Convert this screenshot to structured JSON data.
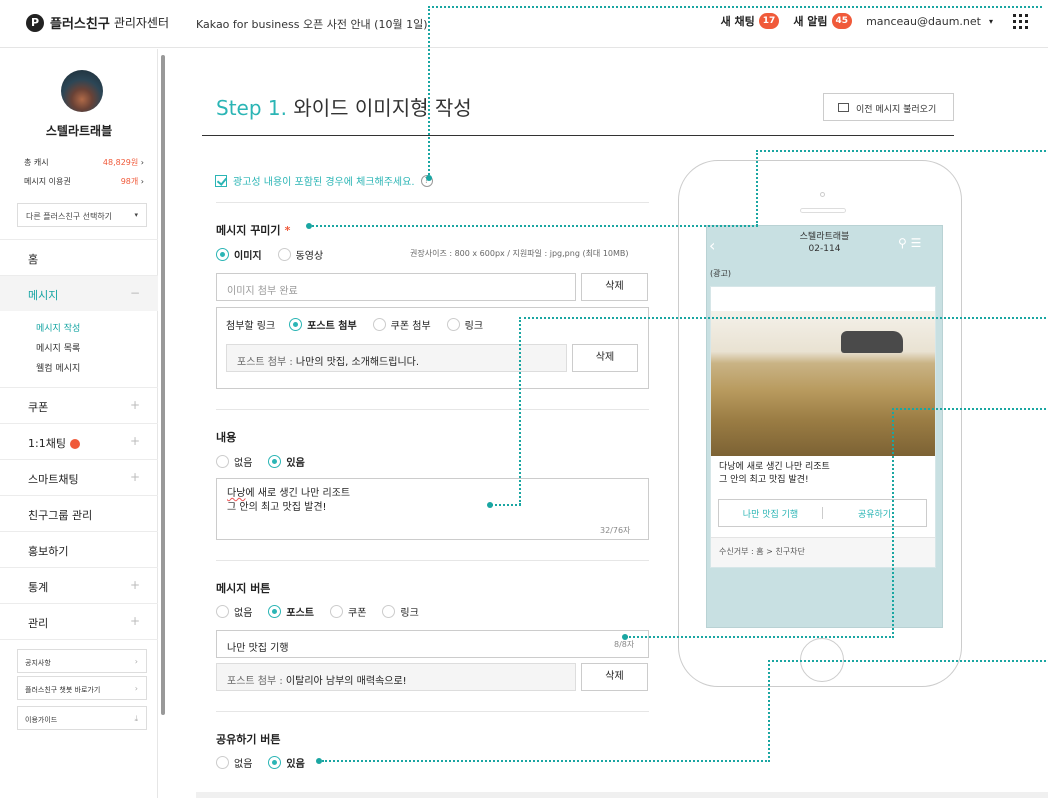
{
  "header": {
    "logo_mark": "P",
    "logo_brand": "플러스친구",
    "logo_sub": "관리자센터",
    "notice": "Kakao for business 오픈 사전 안내 (10월 1일)",
    "chat_label": "새 채팅",
    "chat_count": "17",
    "alert_label": "새 알림",
    "alert_count": "45",
    "email": "manceau@daum.net",
    "email_caret": "▾"
  },
  "sidebar": {
    "profile_name": "스텔라트래블",
    "stats": [
      {
        "label": "총 캐시",
        "value": "48,829원",
        "arrow": "›"
      },
      {
        "label": "메시지 이용권",
        "value": "98개",
        "arrow": "›"
      }
    ],
    "select_label": "다른 플러스친구 선택하기",
    "select_caret": "▾",
    "nav": [
      {
        "label": "홈",
        "pm": ""
      },
      {
        "label": "메시지",
        "pm": "−"
      },
      {
        "label": "쿠폰",
        "pm": "+"
      },
      {
        "label": "1:1채팅",
        "pm": "+"
      },
      {
        "label": "스마트채팅",
        "pm": "+"
      },
      {
        "label": "친구그룹 관리",
        "pm": ""
      },
      {
        "label": "홍보하기",
        "pm": ""
      },
      {
        "label": "통계",
        "pm": "+"
      },
      {
        "label": "관리",
        "pm": "+"
      }
    ],
    "message_sub": [
      "메시지 작성",
      "메시지 목록",
      "웰컴 메시지"
    ],
    "boxes": [
      {
        "label": "공지사항",
        "icon": "›"
      },
      {
        "label": "플러스친구 챗봇 바로가기",
        "icon": "›"
      },
      {
        "label": "이용가이드",
        "icon": "⤓"
      }
    ]
  },
  "main": {
    "step_num": "Step 1.",
    "step_title": "와이드 이미지형 작성",
    "prev_button": "이전 메시지 불러오기",
    "ad_check": "광고성 내용이 포함된 경우에 체크해주세요.",
    "qmark": "?",
    "deco": {
      "title": "메시지 꾸미기",
      "req": "*",
      "options": [
        "이미지",
        "동영상"
      ],
      "hint": "권장사이즈 : 800 x 600px / 지원파일 : jpg,png (최대 10MB)",
      "image_status": "이미지 첨부 완료",
      "delete": "삭제",
      "link_label": "첨부할 링크",
      "link_options": [
        "포스트 첨부",
        "쿠폰 첨부",
        "링크"
      ],
      "post_prefix": "포스트 첨부 :",
      "post_value": "나만의 맛집, 소개해드립니다."
    },
    "content": {
      "title": "내용",
      "options": [
        "없음",
        "있음"
      ],
      "text_l1_a": "다낭",
      "text_l1_b": "에 새로 생긴 나만 리조트",
      "text_l2": "그 안의 최고 맛집 발견!",
      "count": "32/76자"
    },
    "msg_button": {
      "title": "메시지 버튼",
      "options": [
        "없음",
        "포스트",
        "쿠폰",
        "링크"
      ],
      "value": "나만 맛집 기행",
      "count": "8/8자",
      "post_prefix": "포스트 첨부 :",
      "post_value": "이탈리아 남부의 매력속으로!"
    },
    "share": {
      "title": "공유하기 버튼",
      "options": [
        "없음",
        "있음"
      ]
    }
  },
  "preview": {
    "back": "‹",
    "name": "스텔라트래블",
    "number": "02-114",
    "icons": "⚲ ☰",
    "ad_tag": "(광고)",
    "text_l1": "다낭에 새로 생긴 나만 리조트",
    "text_l2": "그 안의 최고 맛집 발견!",
    "btn1": "나만 맛집 기행",
    "btn2": "공유하기",
    "footer": "수신거부 : 홈 > 친구차단"
  },
  "colors": {
    "accent": "#2bb5b5",
    "badge": "#f05a3a",
    "guide": "#1aa6a2",
    "screen": "#c8e0e2"
  }
}
